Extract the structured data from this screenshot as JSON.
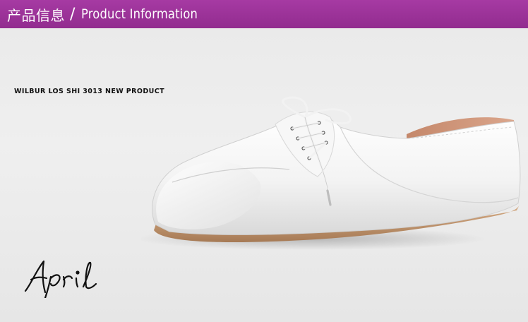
{
  "header": {
    "title_cn": "产品信息",
    "separator": "/",
    "title_en": "Product Information",
    "bar_color": "#9a309a"
  },
  "product": {
    "line": "WILBUR LOS SHI 3013 NEW PRODUCT"
  },
  "image": {
    "subject": "white leather lace-up oxford flat shoe",
    "shoe_color": "#f4f4f4",
    "sole_color": "#c89c76"
  },
  "signature": {
    "text": "April"
  }
}
